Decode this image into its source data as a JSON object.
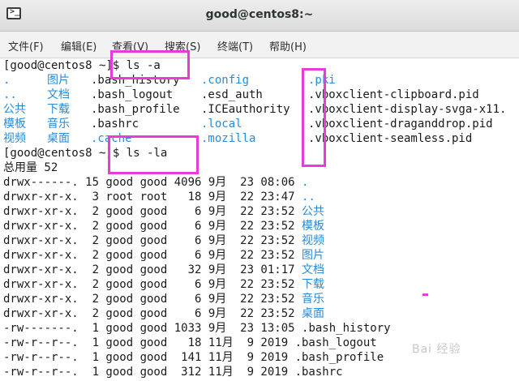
{
  "window": {
    "title": "good@centos8:~",
    "icon": "terminal-icon",
    "icon_glyph": ">_"
  },
  "menu": [
    "文件(F)",
    "编辑(E)",
    "查看(V)",
    "搜索(S)",
    "终端(T)",
    "帮助(H)"
  ],
  "colors": {
    "directory": "#2a8ad6",
    "highlight": "#e83cd8",
    "text": "#1a1a1a"
  },
  "terminal": {
    "prompt1": "[good@centos8 ~]$ ls -a",
    "ls_a": [
      [
        ".",
        "图片",
        ".bash_history",
        ".config",
        ".pki"
      ],
      [
        "..",
        "文档",
        ".bash_logout",
        ".esd_auth",
        ".vboxclient-clipboard.pid"
      ],
      [
        "公共",
        "下载",
        ".bash_profile",
        ".ICEauthority",
        ".vboxclient-display-svga-x11."
      ],
      [
        "模板",
        "音乐",
        ".bashrc",
        ".local",
        ".vboxclient-draganddrop.pid"
      ],
      [
        "视频",
        "桌面",
        ".cache",
        ".mozilla",
        ".vboxclient-seamless.pid"
      ]
    ],
    "prompt2": "[good@centos8 ~]$ ls -la",
    "total": "总用量 52",
    "ls_la": [
      {
        "info": "drwx------. 15 good good 4096 9月  23 08:06 ",
        "name": "."
      },
      {
        "info": "drwxr-xr-x.  3 root root   18 9月  22 23:47 ",
        "name": ".."
      },
      {
        "info": "drwxr-xr-x.  2 good good    6 9月  22 23:52 ",
        "name": "公共"
      },
      {
        "info": "drwxr-xr-x.  2 good good    6 9月  22 23:52 ",
        "name": "模板"
      },
      {
        "info": "drwxr-xr-x.  2 good good    6 9月  22 23:52 ",
        "name": "视频"
      },
      {
        "info": "drwxr-xr-x.  2 good good    6 9月  22 23:52 ",
        "name": "图片"
      },
      {
        "info": "drwxr-xr-x.  2 good good   32 9月  23 01:17 ",
        "name": "文档"
      },
      {
        "info": "drwxr-xr-x.  2 good good    6 9月  22 23:52 ",
        "name": "下载"
      },
      {
        "info": "drwxr-xr-x.  2 good good    6 9月  22 23:52 ",
        "name": "音乐"
      },
      {
        "info": "drwxr-xr-x.  2 good good    6 9月  22 23:52 ",
        "name": "桌面"
      },
      {
        "info": "-rw-------.  1 good good 1033 9月  23 13:05 ",
        "name": ".bash_history"
      },
      {
        "info": "-rw-r--r--.  1 good good   18 11月  9 2019 ",
        "name": ".bash_logout"
      },
      {
        "info": "-rw-r--r--.  1 good good  141 11月  9 2019 ",
        "name": ".bash_profile"
      },
      {
        "info": "-rw-r--r--.  1 good good  312 11月  9 2019 ",
        "name": ".bashrc"
      }
    ]
  },
  "watermark": "Bai 经验"
}
